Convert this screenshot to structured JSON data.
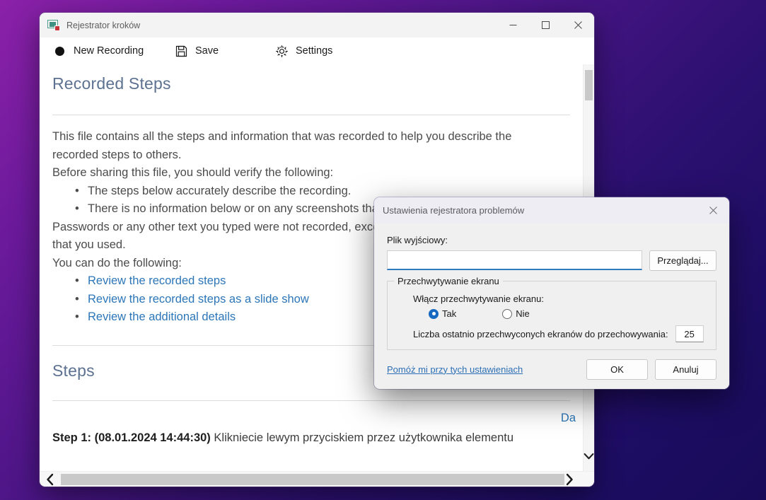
{
  "desktop": {
    "background_start": "#8b21a8",
    "background_end": "#190b58"
  },
  "main_window": {
    "title": "Rejestrator kroków",
    "icon": "recorder-monitor-icon",
    "controls": {
      "minimize_label": "Minimize",
      "maximize_label": "Maximize",
      "close_label": "Close"
    },
    "toolbar": {
      "new_recording_label": "New Recording",
      "save_label": "Save",
      "settings_label": "Settings"
    },
    "document": {
      "heading": "Recorded Steps",
      "intro_line_1": "This file contains all the steps and information that was recorded to help you describe the",
      "intro_line_2": "recorded steps to others.",
      "verify_intro": "Before sharing this file, you should verify the following:",
      "verify_bullets": [
        "The steps below accurately describe the recording.",
        "There is no information below or on any screenshots that you do not want others to see."
      ],
      "passwords_line_1": "Passwords or any other text you typed were not recorded, except for function and shortcut keys",
      "passwords_line_2": "that you used.",
      "actions_intro": "You can do the following:",
      "action_links": [
        "Review the recorded steps",
        "Review the recorded steps as a slide show",
        "Review the additional details"
      ],
      "right_truncated_link": "Da",
      "steps_heading": "Steps",
      "step_1_prefix": "Step 1: (08.01.2024 14:44:30)",
      "step_1_text": "Klikniecie lewym przyciskiem przez użytkownika elementu"
    },
    "scrollbars": {
      "vertical_chevron": "chevron-down",
      "horizontal_left_arrow": "chevron-left",
      "horizontal_right_arrow": "chevron-right"
    }
  },
  "settings_dialog": {
    "title": "Ustawienia rejestratora problemów",
    "close_label": "Close",
    "output_file_label": "Plik wyjściowy:",
    "output_file_value": "",
    "output_file_placeholder": "",
    "browse_button": "Przeglądaj...",
    "group_legend": "Przechwytywanie ekranu",
    "enable_capture_label": "Włącz przechwytywanie ekranu:",
    "radio_options": [
      {
        "label": "Tak",
        "checked": true
      },
      {
        "label": "Nie",
        "checked": false
      }
    ],
    "count_label": "Liczba ostatnio przechwyconych ekranów do przechowywania:",
    "count_value": "25",
    "help_link": "Pomóż mi przy tych ustawieniach",
    "ok_button": "OK",
    "cancel_button": "Anuluj",
    "accent_color": "#2e7bbf"
  }
}
